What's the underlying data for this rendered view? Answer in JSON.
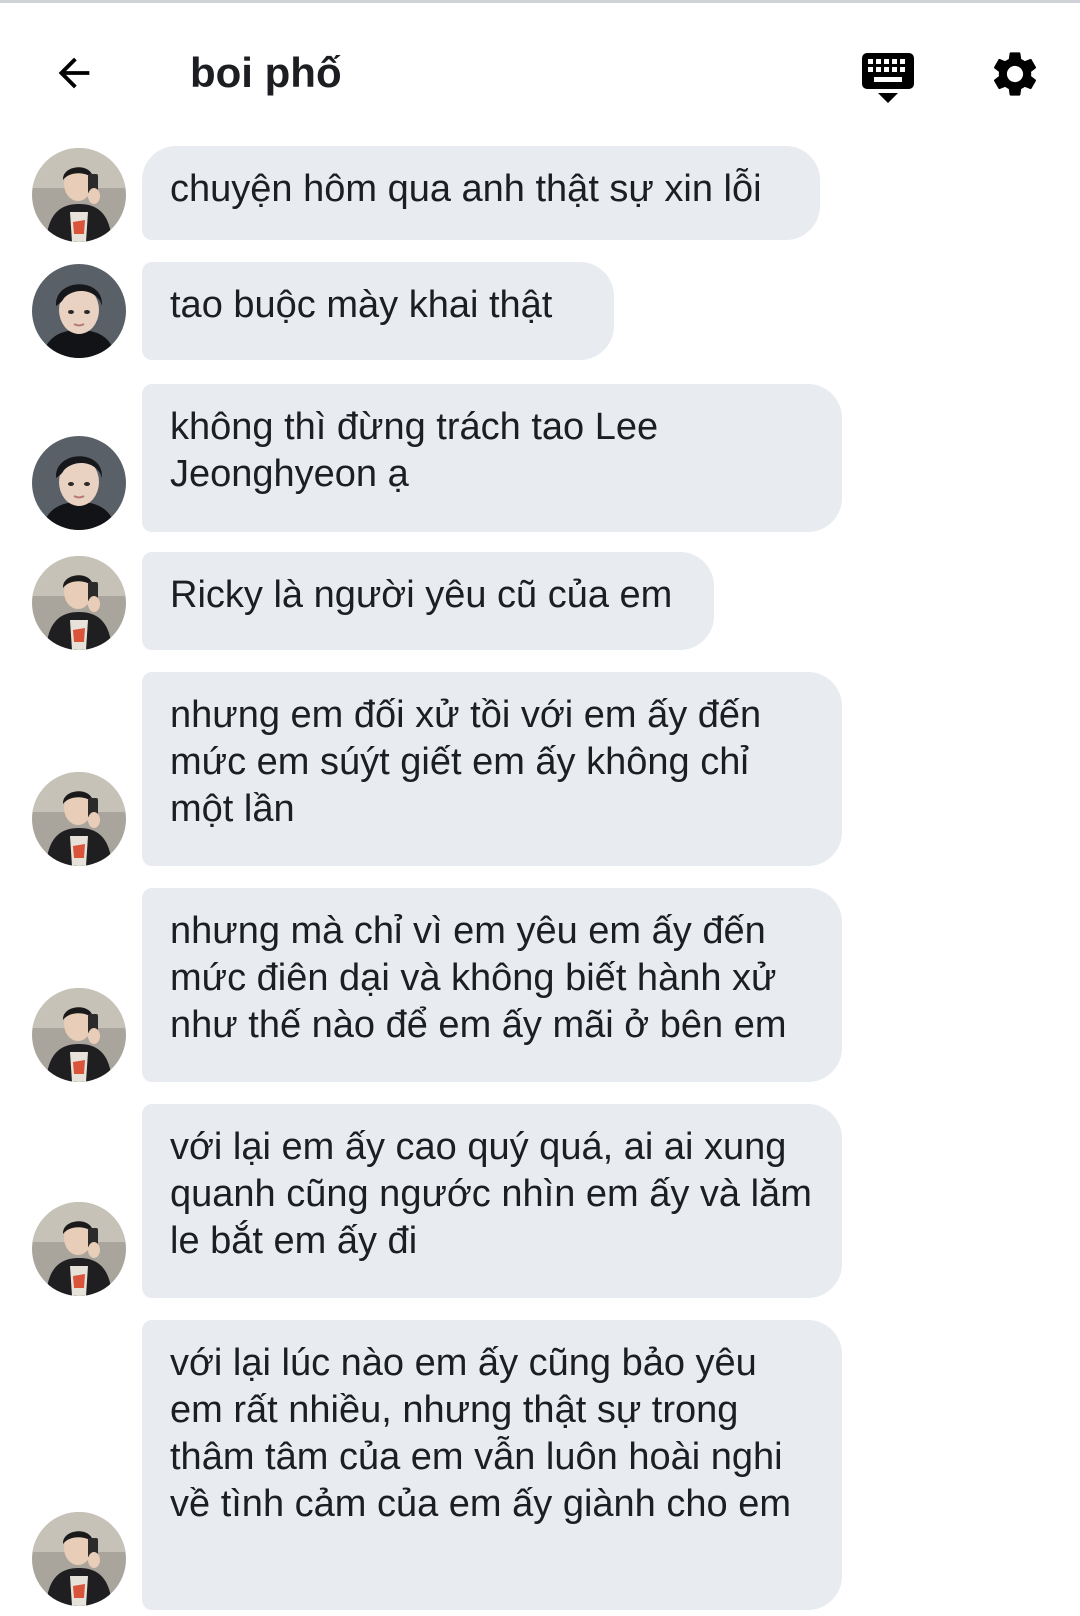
{
  "header": {
    "title": "boi phố",
    "icons": {
      "back": "arrow-left-icon",
      "keyboard": "keyboard-icon",
      "settings": "gear-icon"
    }
  },
  "colors": {
    "bubble": "#e8ebef",
    "text": "#1c1e21",
    "icon": "#000000",
    "background": "#ffffff"
  },
  "messages": [
    {
      "text": "chuyện hôm qua anh thật sự xin lỗi",
      "avatar": "avatar-selfie"
    },
    {
      "text": "tao buộc mày khai thật",
      "avatar": "avatar-portrait"
    },
    {
      "text": "không thì đừng trách tao Lee Jeonghyeon ạ",
      "avatar": "avatar-portrait"
    },
    {
      "text": "Ricky là người yêu cũ của em",
      "avatar": "avatar-selfie"
    },
    {
      "text": "nhưng em đối xử tồi với em ấy đến mức em súýt giết em ấy không chỉ một lần",
      "avatar": "avatar-selfie"
    },
    {
      "text": "nhưng mà chỉ vì em yêu em ấy đến mức điên dại và không biết hành xử như thế nào để em ấy mãi ở bên em",
      "avatar": "avatar-selfie"
    },
    {
      "text": "với lại em ấy cao quý quá, ai ai xung quanh cũng ngước nhìn em ấy và lăm le bắt em ấy đi",
      "avatar": "avatar-selfie"
    },
    {
      "text": "với lại lúc nào em ấy cũng bảo yêu em rất nhiều, nhưng thật sự trong thâm tâm của em vẫn luôn hoài nghi về tình cảm của em ấy giành cho em",
      "avatar": "avatar-selfie"
    }
  ]
}
